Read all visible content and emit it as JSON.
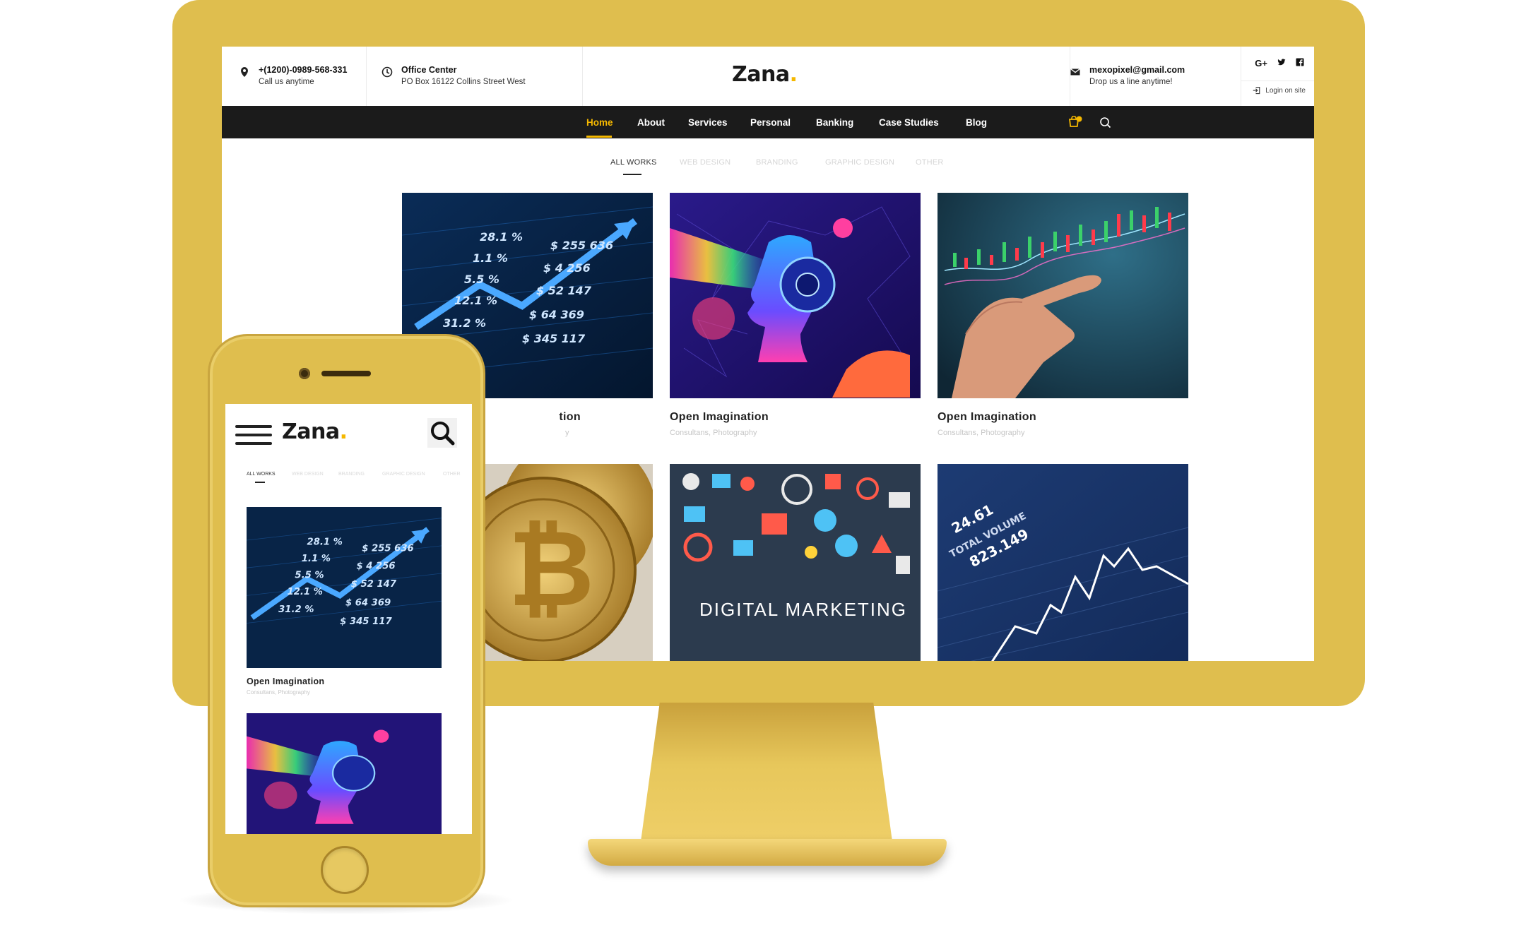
{
  "header": {
    "phone": "+(1200)-0989-568-331",
    "phone_sub": "Call us anytime",
    "office_title": "Office Center",
    "office_sub": "PO Box 16122 Collins Street West",
    "logo_text": "Zana",
    "logo_dot": ".",
    "email": "mexopixel@gmail.com",
    "email_sub": "Drop us a line anytime!",
    "social": [
      {
        "label": "G+",
        "icon": "google-plus-icon"
      },
      {
        "label": "𝕥",
        "icon": "twitter-icon"
      },
      {
        "label": "f",
        "icon": "facebook-icon"
      }
    ],
    "login": "Login on site"
  },
  "nav": {
    "items": [
      "Home",
      "About",
      "Services",
      "Personal",
      "Banking",
      "Case Studies",
      "Blog"
    ],
    "active": "Home",
    "cart_count": "0"
  },
  "filters": [
    "ALL WORKS",
    "WEB DESIGN",
    "BRANDING",
    "GRAPHIC DESIGN",
    "OTHER"
  ],
  "gallery": [
    {
      "title": "Open Imagination",
      "title_visible": "tion",
      "sub": "Consultans, Photography",
      "sub_visible": "y",
      "image": "stock-market-arrow"
    },
    {
      "title": "Open Imagination",
      "sub": "Consultans, Photography",
      "image": "neon-head-illustration"
    },
    {
      "title": "Open Imagination",
      "sub": "Consultans, Photography",
      "image": "hand-candlestick-chart"
    },
    {
      "image": "gold-bitcoin-coins"
    },
    {
      "image": "digital-marketing-icons",
      "overlay_text": "DIGITAL MARKETING"
    },
    {
      "image": "total-volume-line-chart",
      "overlay_text_1": "24.61",
      "overlay_text_2": "TOTAL VOLUME",
      "overlay_text_3": "823.149"
    }
  ],
  "mobile": {
    "logo_text": "Zana",
    "logo_dot": ".",
    "filters": [
      "ALL WORKS",
      "WEB DESIGN",
      "BRANDING",
      "GRAPHIC DESIGN",
      "OTHER"
    ],
    "items": [
      {
        "title": "Open Imagination",
        "sub": "Consultans, Photography",
        "image": "stock-market-arrow"
      },
      {
        "image": "neon-head-illustration"
      }
    ]
  },
  "colors": {
    "device_gold": "#dfbe4e",
    "accent": "#f5b800",
    "nav_bg": "#1b1b1b"
  }
}
